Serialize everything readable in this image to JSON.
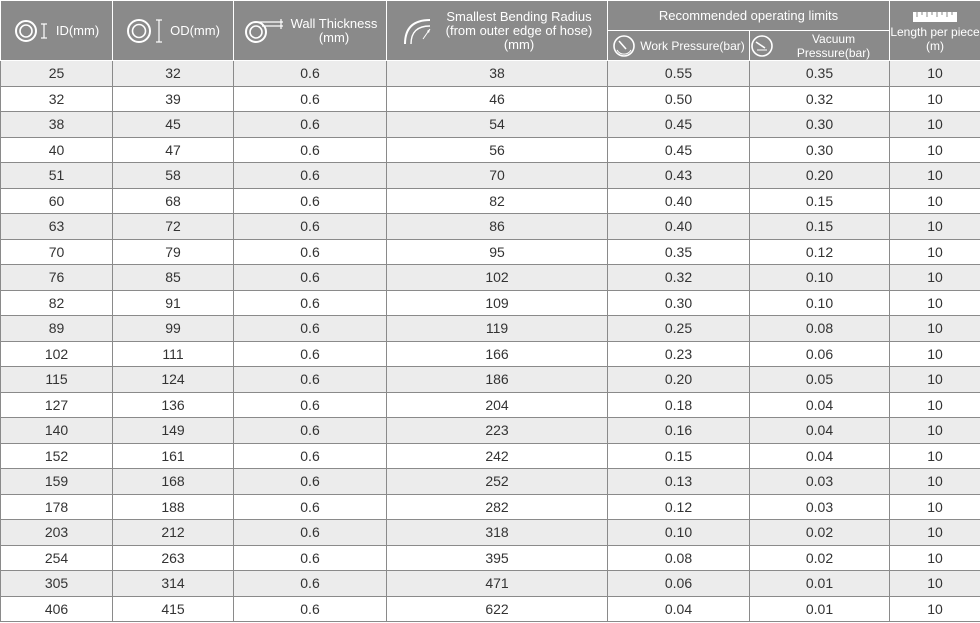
{
  "headers": {
    "id": "ID(mm)",
    "od": "OD(mm)",
    "wall_line1": "Wall Thickness",
    "wall_line2": "(mm)",
    "bend_line1": "Smallest Bending Radius",
    "bend_line2": "(from outer edge of hose)",
    "bend_line3": "(mm)",
    "limits": "Recommended operating limits",
    "work_pressure": "Work Pressure(bar)",
    "vacuum_pressure": "Vacuum Pressure(bar)",
    "length_line1": "Length per piece",
    "length_line2": "(m)"
  },
  "icons": {
    "id": "hose-ring-id-icon",
    "od": "hose-ring-od-icon",
    "wall": "hose-wall-icon",
    "bend": "bend-radius-icon",
    "work": "pressure-gauge-icon",
    "vacuum": "vacuum-gauge-icon",
    "length": "ruler-icon"
  },
  "colors": {
    "header_bg": "#8a8a8a",
    "header_text": "#ffffff",
    "row_odd": "#ececec",
    "row_even": "#ffffff",
    "cell_text": "#333333"
  },
  "rows": [
    [
      "25",
      "32",
      "0.6",
      "38",
      "0.55",
      "0.35",
      "10"
    ],
    [
      "32",
      "39",
      "0.6",
      "46",
      "0.50",
      "0.32",
      "10"
    ],
    [
      "38",
      "45",
      "0.6",
      "54",
      "0.45",
      "0.30",
      "10"
    ],
    [
      "40",
      "47",
      "0.6",
      "56",
      "0.45",
      "0.30",
      "10"
    ],
    [
      "51",
      "58",
      "0.6",
      "70",
      "0.43",
      "0.20",
      "10"
    ],
    [
      "60",
      "68",
      "0.6",
      "82",
      "0.40",
      "0.15",
      "10"
    ],
    [
      "63",
      "72",
      "0.6",
      "86",
      "0.40",
      "0.15",
      "10"
    ],
    [
      "70",
      "79",
      "0.6",
      "95",
      "0.35",
      "0.12",
      "10"
    ],
    [
      "76",
      "85",
      "0.6",
      "102",
      "0.32",
      "0.10",
      "10"
    ],
    [
      "82",
      "91",
      "0.6",
      "109",
      "0.30",
      "0.10",
      "10"
    ],
    [
      "89",
      "99",
      "0.6",
      "119",
      "0.25",
      "0.08",
      "10"
    ],
    [
      "102",
      "111",
      "0.6",
      "166",
      "0.23",
      "0.06",
      "10"
    ],
    [
      "115",
      "124",
      "0.6",
      "186",
      "0.20",
      "0.05",
      "10"
    ],
    [
      "127",
      "136",
      "0.6",
      "204",
      "0.18",
      "0.04",
      "10"
    ],
    [
      "140",
      "149",
      "0.6",
      "223",
      "0.16",
      "0.04",
      "10"
    ],
    [
      "152",
      "161",
      "0.6",
      "242",
      "0.15",
      "0.04",
      "10"
    ],
    [
      "159",
      "168",
      "0.6",
      "252",
      "0.13",
      "0.03",
      "10"
    ],
    [
      "178",
      "188",
      "0.6",
      "282",
      "0.12",
      "0.03",
      "10"
    ],
    [
      "203",
      "212",
      "0.6",
      "318",
      "0.10",
      "0.02",
      "10"
    ],
    [
      "254",
      "263",
      "0.6",
      "395",
      "0.08",
      "0.02",
      "10"
    ],
    [
      "305",
      "314",
      "0.6",
      "471",
      "0.06",
      "0.01",
      "10"
    ],
    [
      "406",
      "415",
      "0.6",
      "622",
      "0.04",
      "0.01",
      "10"
    ]
  ]
}
